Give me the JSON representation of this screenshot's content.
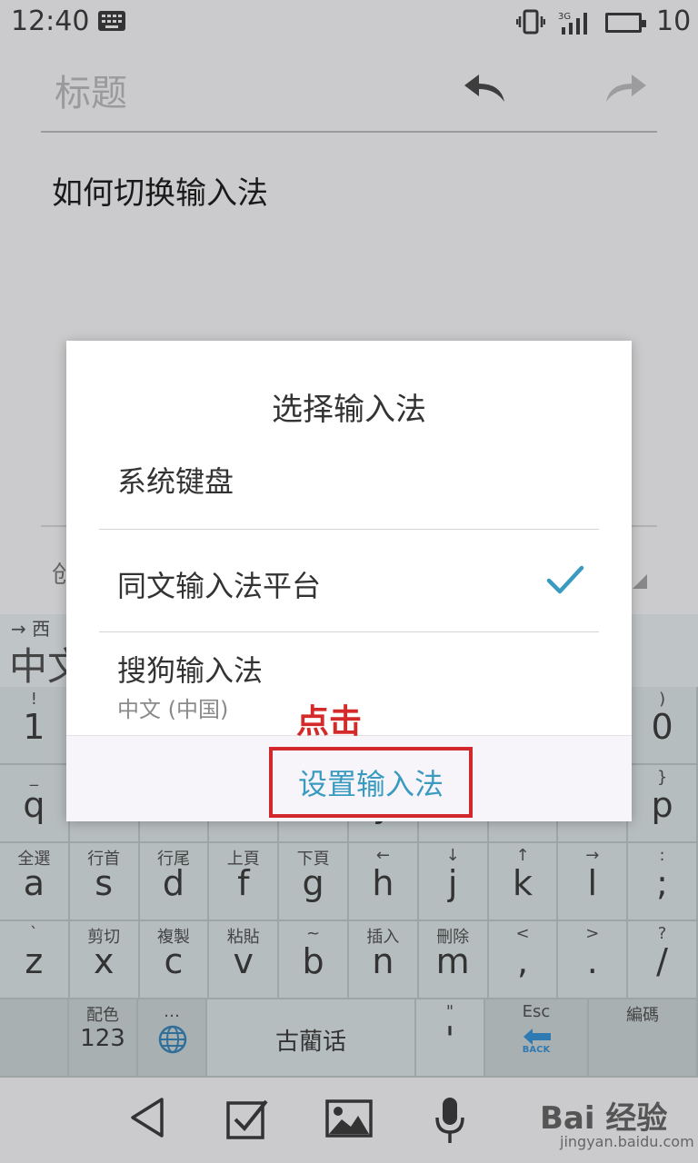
{
  "status": {
    "time": "12:40",
    "battery": "10",
    "network": "3G"
  },
  "editor": {
    "title_placeholder": "标题",
    "body": "如何切换输入法",
    "bottom_fragment": "创"
  },
  "candidates": {
    "hint": "→ 西",
    "main": "中文"
  },
  "keyboard": {
    "row1": [
      {
        "top": "!",
        "main": "1"
      },
      {
        "top": "",
        "main": ""
      },
      {
        "top": "",
        "main": ""
      },
      {
        "top": "",
        "main": ""
      },
      {
        "top": "",
        "main": ""
      },
      {
        "top": "",
        "main": ""
      },
      {
        "top": "",
        "main": ""
      },
      {
        "top": "",
        "main": ""
      },
      {
        "top": "",
        "main": ""
      },
      {
        "top": ")",
        "main": "0"
      }
    ],
    "row2": [
      {
        "top": "_",
        "main": "q"
      },
      {
        "top": "",
        "main": ""
      },
      {
        "top": "",
        "main": ""
      },
      {
        "top": "",
        "main": ""
      },
      {
        "top": "",
        "main": ""
      },
      {
        "top": "",
        "main": "y"
      },
      {
        "top": "",
        "main": ""
      },
      {
        "top": "",
        "main": ""
      },
      {
        "top": "",
        "main": ""
      },
      {
        "top": "}",
        "main": "p"
      }
    ],
    "row3": [
      {
        "top": "全選",
        "main": "a"
      },
      {
        "top": "行首",
        "main": "s"
      },
      {
        "top": "行尾",
        "main": "d"
      },
      {
        "top": "上頁",
        "main": "f"
      },
      {
        "top": "下頁",
        "main": "g"
      },
      {
        "top": "←",
        "main": "h"
      },
      {
        "top": "↓",
        "main": "j"
      },
      {
        "top": "↑",
        "main": "k"
      },
      {
        "top": "→",
        "main": "l"
      },
      {
        "top": ":",
        "main": ";"
      }
    ],
    "row4": [
      {
        "top": "`",
        "main": "z"
      },
      {
        "top": "剪切",
        "main": "x"
      },
      {
        "top": "複製",
        "main": "c"
      },
      {
        "top": "粘貼",
        "main": "v"
      },
      {
        "top": "~",
        "main": "b"
      },
      {
        "top": "插入",
        "main": "n"
      },
      {
        "top": "刪除",
        "main": "m"
      },
      {
        "top": "<",
        "main": ","
      },
      {
        "top": ">",
        "main": "."
      },
      {
        "top": "?",
        "main": "/"
      }
    ],
    "row5": {
      "k123_top": "配色",
      "k123_main": "123",
      "globe_top": "…",
      "space": "古藺话",
      "quote_top": "\"",
      "quote_main": "'",
      "esc_top": "Esc",
      "esc_sub": "BACK",
      "encode_top": "編碼"
    }
  },
  "dialog": {
    "title": "选择输入法",
    "options": [
      {
        "label": "系统键盘",
        "sub": ""
      },
      {
        "label": "同文输入法平台",
        "sub": ""
      },
      {
        "label": "搜狗输入法",
        "sub": "中文 (中国)"
      }
    ],
    "settings_label": "设置输入法"
  },
  "annotation": {
    "click_label": "点击"
  },
  "watermark": {
    "brand": "Bai 经验",
    "url": "jingyan.baidu.com"
  },
  "colors": {
    "accent": "#3a9ac0",
    "highlight_border": "#d1272d",
    "annotation": "#d42a2a"
  },
  "icons": [
    "keyboard-icon",
    "vibrate-icon",
    "signal-icon",
    "battery-icon",
    "undo-icon",
    "redo-icon",
    "checkmark-icon",
    "globe-icon",
    "back-arrow-icon",
    "nav-back-icon",
    "checkbox-icon",
    "image-icon",
    "mic-icon"
  ]
}
